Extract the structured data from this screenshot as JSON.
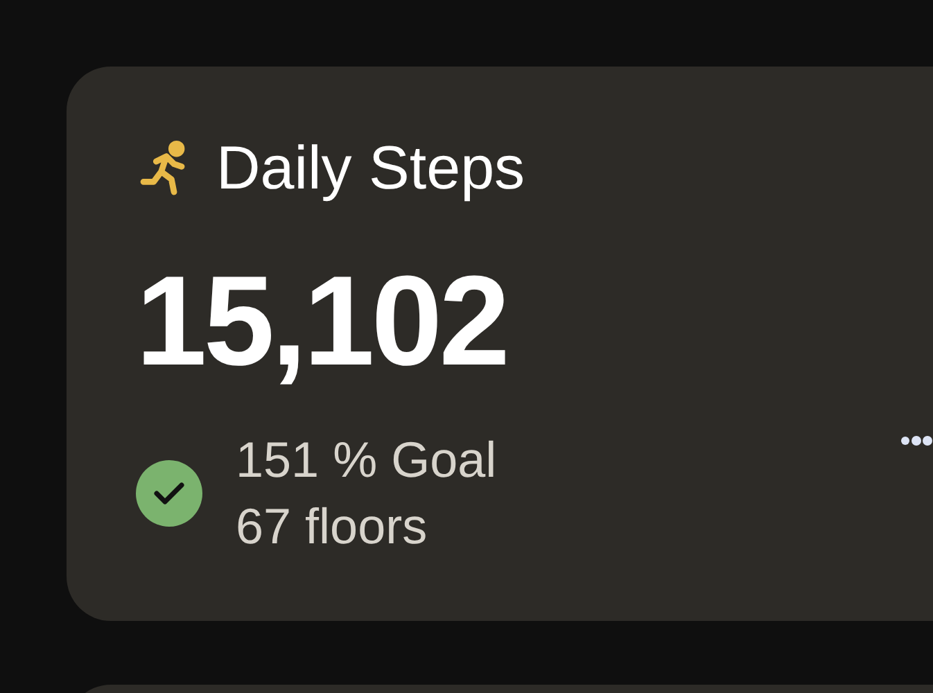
{
  "card": {
    "title": "Daily Steps",
    "value": "15,102",
    "goal_met": true,
    "details": [
      "151 % Goal",
      "67 floors"
    ]
  }
}
